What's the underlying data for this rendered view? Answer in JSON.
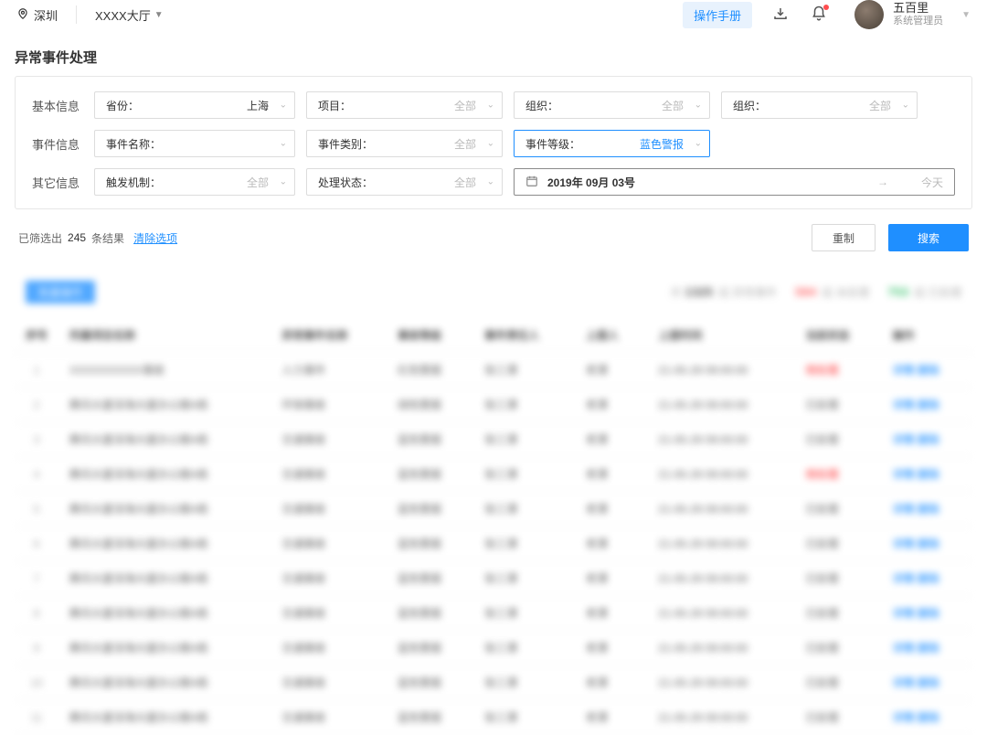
{
  "header": {
    "location": "深圳",
    "building": "XXXX大厅",
    "manual_btn": "操作手册",
    "user": {
      "name": "五百里",
      "role": "系统管理员"
    }
  },
  "page_title": "异常事件处理",
  "filters": {
    "row1_label": "基本信息",
    "row2_label": "事件信息",
    "row3_label": "其它信息",
    "all_text": "全部",
    "province": {
      "label": "省份：",
      "value": "上海"
    },
    "project": {
      "label": "项目："
    },
    "org1": {
      "label": "组织："
    },
    "org2": {
      "label": "组织："
    },
    "event_name": {
      "label": "事件名称："
    },
    "event_type": {
      "label": "事件类别："
    },
    "event_level": {
      "label": "事件等级：",
      "value": "蓝色警报"
    },
    "trigger": {
      "label": "触发机制："
    },
    "status": {
      "label": "处理状态："
    },
    "date_value": "2019年 09月 03号",
    "today_text": "今天"
  },
  "results": {
    "prefix": "已筛选出",
    "count": "245",
    "suffix": "条结果",
    "clear": "清除选项",
    "reset_btn": "重制",
    "search_btn": "搜索"
  },
  "blurred": {
    "mini_btn": "批量操作",
    "total": {
      "n": "1325",
      "lbl": "起 异常事件"
    },
    "pending": {
      "n": "584",
      "lbl": "起 未处理"
    },
    "done": {
      "n": "753",
      "lbl": "起 已处理"
    },
    "columns": [
      "序号",
      "所属项目名称",
      "异常事件名称",
      "事故等级",
      "事件责任人",
      "上报人",
      "上报时间",
      "当前状态",
      "操作"
    ],
    "rows": [
      {
        "i": 1,
        "proj": "XXXXXXXXXX事故",
        "name": "人力事件",
        "lvl": "红色警报",
        "owner": "张三潭",
        "rep": "老潭",
        "time": "21-05-29 09:00:00",
        "st": "待处理",
        "st_red": true
      },
      {
        "i": 2,
        "proj": "腾讯大厦深海大厦办公楼A栋",
        "name": "环保事故",
        "lvl": "绿色警报",
        "owner": "张三潭",
        "rep": "老潭",
        "time": "21-05-29 09:00:00",
        "st": "已处理",
        "st_red": false
      },
      {
        "i": 3,
        "proj": "腾讯大厦深海大厦办公楼A栋",
        "name": "交通事故",
        "lvl": "蓝色警报",
        "owner": "张三潭",
        "rep": "老潭",
        "time": "21-05-29 09:00:00",
        "st": "已处理",
        "st_red": false
      },
      {
        "i": 4,
        "proj": "腾讯大厦深海大厦办公楼A栋",
        "name": "交通事故",
        "lvl": "蓝色警报",
        "owner": "张三潭",
        "rep": "老潭",
        "time": "21-05-29 09:00:00",
        "st": "待处理",
        "st_red": true
      },
      {
        "i": 5,
        "proj": "腾讯大厦深海大厦办公楼A栋",
        "name": "交通事故",
        "lvl": "蓝色警报",
        "owner": "张三潭",
        "rep": "老潭",
        "time": "21-05-29 09:00:00",
        "st": "已处理",
        "st_red": false
      },
      {
        "i": 6,
        "proj": "腾讯大厦深海大厦办公楼A栋",
        "name": "交通事故",
        "lvl": "蓝色警报",
        "owner": "张三潭",
        "rep": "老潭",
        "time": "21-05-29 09:00:00",
        "st": "已处理",
        "st_red": false
      },
      {
        "i": 7,
        "proj": "腾讯大厦深海大厦办公楼A栋",
        "name": "交通事故",
        "lvl": "蓝色警报",
        "owner": "张三潭",
        "rep": "老潭",
        "time": "21-05-29 09:00:00",
        "st": "已处理",
        "st_red": false
      },
      {
        "i": 8,
        "proj": "腾讯大厦深海大厦办公楼A栋",
        "name": "交通事故",
        "lvl": "蓝色警报",
        "owner": "张三潭",
        "rep": "老潭",
        "time": "21-05-29 09:00:00",
        "st": "已处理",
        "st_red": false
      },
      {
        "i": 9,
        "proj": "腾讯大厦深海大厦办公楼A栋",
        "name": "交通事故",
        "lvl": "蓝色警报",
        "owner": "张三潭",
        "rep": "老潭",
        "time": "21-05-29 09:00:00",
        "st": "已处理",
        "st_red": false
      },
      {
        "i": 10,
        "proj": "腾讯大厦深海大厦办公楼A栋",
        "name": "交通事故",
        "lvl": "蓝色警报",
        "owner": "张三潭",
        "rep": "老潭",
        "time": "21-05-29 09:00:00",
        "st": "已处理",
        "st_red": false
      },
      {
        "i": 11,
        "proj": "腾讯大厦深海大厦办公楼A栋",
        "name": "交通事故",
        "lvl": "蓝色警报",
        "owner": "张三潭",
        "rep": "老潭",
        "time": "21-05-29 09:00:00",
        "st": "已处理",
        "st_red": false
      }
    ],
    "action_text": "详情 删除"
  }
}
